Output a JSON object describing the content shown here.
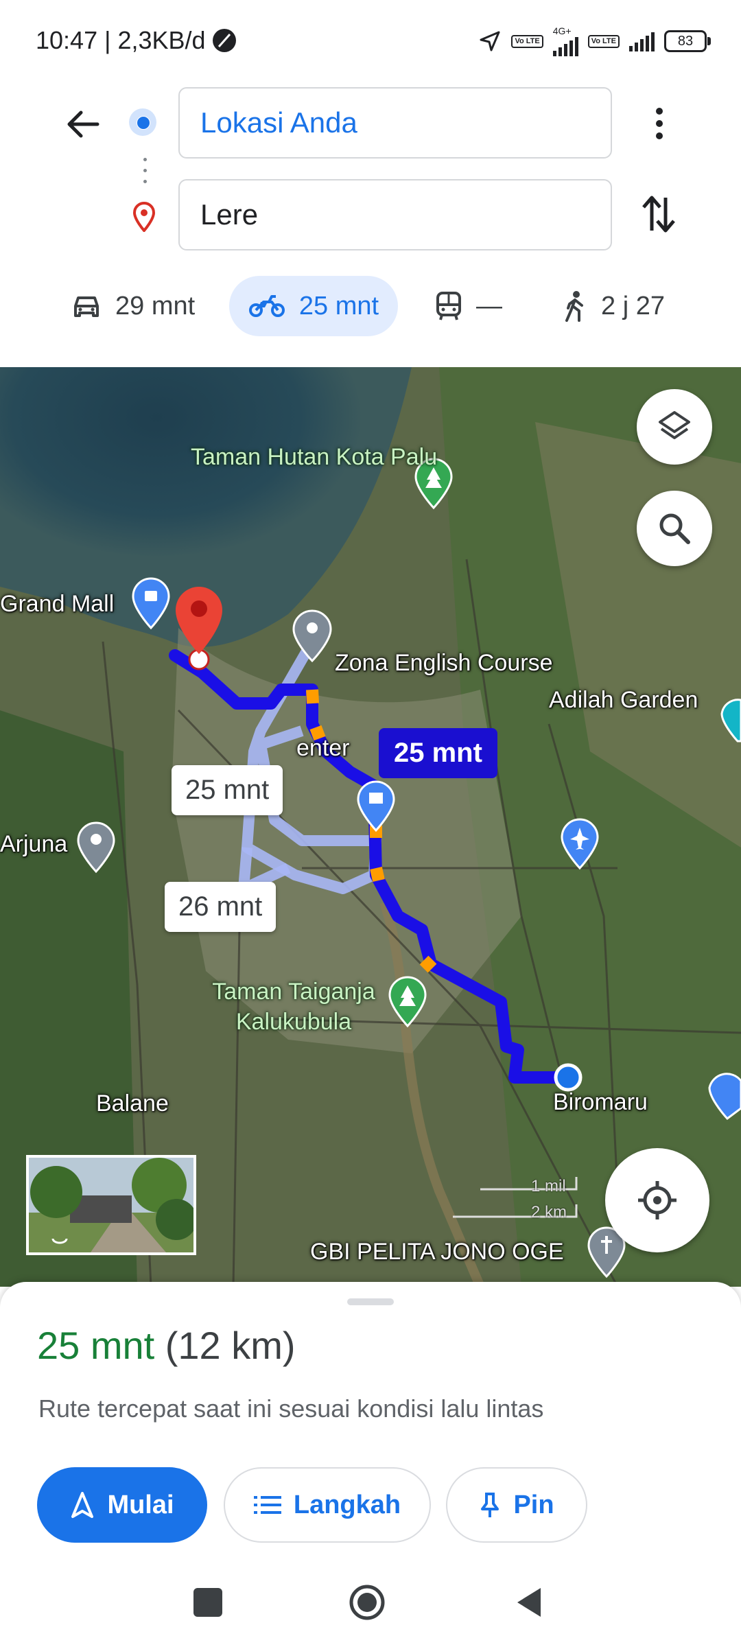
{
  "status_bar": {
    "time": "10:47 | 2,3KB/d",
    "network_type": "4G+",
    "volte_1": "Vo LTE",
    "volte_2": "Vo LTE",
    "battery": "83"
  },
  "directions": {
    "origin": "Lokasi Anda",
    "destination": "Lere"
  },
  "modes": [
    {
      "name": "car",
      "label": "29 mnt"
    },
    {
      "name": "motorcycle",
      "label": "25 mnt",
      "selected": true
    },
    {
      "name": "transit",
      "label": "—"
    },
    {
      "name": "walk",
      "label": "2 j 27"
    }
  ],
  "map": {
    "places": {
      "taman_hutan": "Taman Hutan Kota Palu",
      "grand_mall": "Grand Mall",
      "zona_english": "Zona English Course",
      "adilah_garden": "Adilah Garden",
      "center": "enter",
      "arjuna": "Arjuna",
      "taman_taiganja": "Taman Taiganja Kalukubula",
      "balane": "Balane",
      "biromaru": "Biromaru",
      "gbi": "GBI PELITA JONO OGE"
    },
    "route_times": {
      "main": "25 mnt",
      "alt_1": "25 mnt",
      "alt_2": "26 mnt"
    },
    "scale": {
      "miles": "1 mil",
      "km": "2 km"
    },
    "colors": {
      "route": "#1a0fe6",
      "alt_route": "#a8b7f5"
    }
  },
  "sheet": {
    "time": "25 mnt",
    "distance": "(12 km)",
    "subtitle": "Rute tercepat saat ini sesuai kondisi lalu lintas",
    "start_label": "Mulai",
    "steps_label": "Langkah",
    "pin_label": "Pin"
  },
  "colors": {
    "accent": "#1a73e8",
    "eta_green": "#188038"
  }
}
